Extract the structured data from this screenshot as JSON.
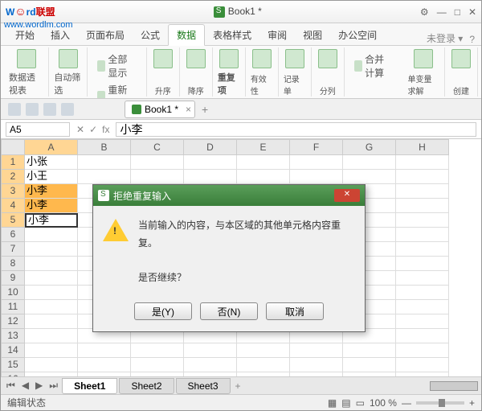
{
  "title": {
    "watermark1": "W",
    "watermark2": "rd",
    "watermark3": "联盟",
    "url": "www.wordlm.com",
    "doc": "Book1 *"
  },
  "winbtns": {
    "cog": "⚙",
    "min": "—",
    "max": "□",
    "close": "✕"
  },
  "menu": {
    "items": [
      "开始",
      "插入",
      "页面布局",
      "公式",
      "数据",
      "表格样式",
      "审阅",
      "视图",
      "办公空间"
    ],
    "active": 4,
    "login": "未登录 ▾",
    "help": "?"
  },
  "ribbon": {
    "g1": "数据透视表",
    "g2": "自动筛选",
    "g2a": "全部显示",
    "g2b": "重新应用",
    "g3a": "升序",
    "g3b": "降序",
    "g4": "重复项",
    "g5": "有效性",
    "g6": "记录单",
    "g7": "分列",
    "g8a": "合并计算",
    "g8": "单变量求解",
    "g9": "创建"
  },
  "qat": {
    "doctab": "Book1 *",
    "close": "×",
    "add": "+"
  },
  "fbar": {
    "name": "A5",
    "x": "✕",
    "ok": "✓",
    "fx": "fx",
    "val": "小李"
  },
  "cols": [
    "A",
    "B",
    "C",
    "D",
    "E",
    "F",
    "G",
    "H"
  ],
  "rows": 16,
  "cells": {
    "A1": "小张",
    "A2": "小王",
    "A3": "小李",
    "A4": "小李",
    "A5": "小李"
  },
  "highlight": [
    "A3",
    "A4"
  ],
  "active": "A5",
  "sheets": {
    "nav": [
      "⏮",
      "◀",
      "▶",
      "⏭"
    ],
    "tabs": [
      "Sheet1",
      "Sheet2",
      "Sheet3"
    ],
    "active": 0,
    "add": "+"
  },
  "status": {
    "text": "编辑状态",
    "vicons": [
      "▦",
      "▤",
      "▭"
    ],
    "zoom": "100 %",
    "zm": "—",
    "zp": "+"
  },
  "dialog": {
    "title": "拒绝重复输入",
    "msg1": "当前输入的内容，与本区域的其他单元格内容重复。",
    "msg2": "是否继续？",
    "yes": "是(Y)",
    "no": "否(N)",
    "cancel": "取消",
    "close": "✕"
  }
}
